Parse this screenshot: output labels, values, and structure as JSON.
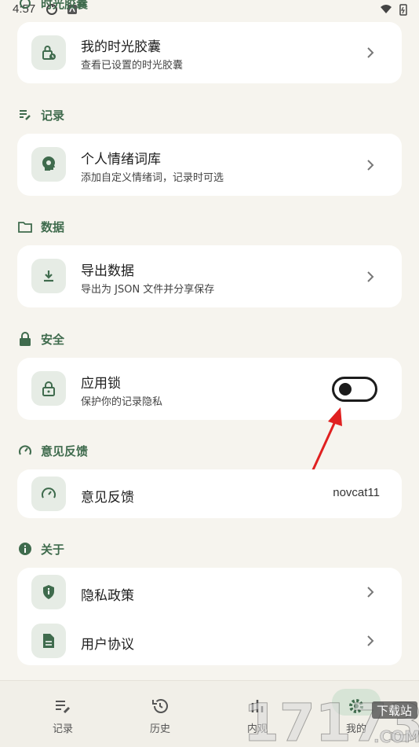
{
  "status": {
    "time": "4:57"
  },
  "sections": {
    "capsule": {
      "title": "时光胶囊"
    },
    "record": {
      "title": "记录"
    },
    "data": {
      "title": "数据"
    },
    "security": {
      "title": "安全"
    },
    "feedback": {
      "title": "意见反馈"
    },
    "about": {
      "title": "关于"
    }
  },
  "rows": {
    "my_capsule": {
      "title": "我的时光胶囊",
      "subtitle": "查看已设置的时光胶囊"
    },
    "emotion_lexicon": {
      "title": "个人情绪词库",
      "subtitle": "添加自定义情绪词，记录时可选"
    },
    "export_data": {
      "title": "导出数据",
      "subtitle": "导出为 JSON 文件并分享保存"
    },
    "app_lock": {
      "title": "应用锁",
      "subtitle": "保护你的记录隐私",
      "enabled": false
    },
    "feedback": {
      "title": "意见反馈",
      "value": "novcat11"
    },
    "privacy_policy": {
      "title": "隐私政策"
    },
    "user_agreement": {
      "title": "用户协议"
    }
  },
  "bottom_nav": {
    "items": [
      {
        "label": "记录",
        "icon": "edit-list-icon"
      },
      {
        "label": "历史",
        "icon": "history-icon"
      },
      {
        "label": "内观",
        "icon": "insight-icon"
      },
      {
        "label": "我的",
        "icon": "gear-icon",
        "active": true
      }
    ]
  },
  "watermark": {
    "text": "17173",
    "badge": "下载站",
    "suffix": ".COM"
  },
  "colors": {
    "accent": "#3f6b4d",
    "annotation_arrow": "#e02020",
    "background": "#f6f4ee"
  }
}
